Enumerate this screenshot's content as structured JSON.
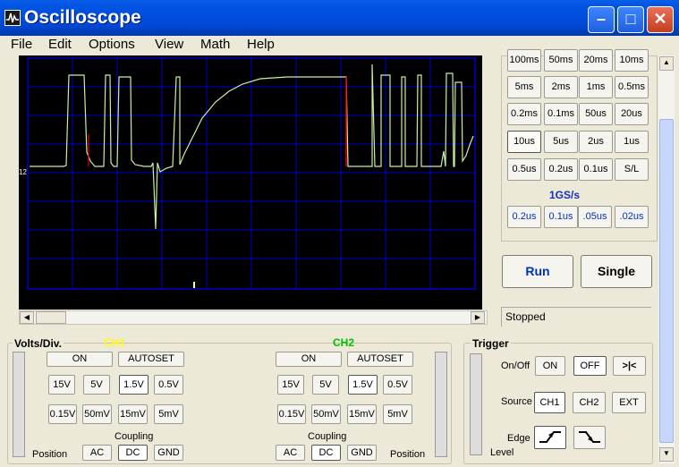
{
  "window": {
    "title": "Oscilloscope"
  },
  "menu": [
    "File",
    "Edit",
    "Options",
    "View",
    "Math",
    "Help"
  ],
  "timebase": {
    "rows": [
      [
        "100ms",
        "50ms",
        "20ms",
        "10ms"
      ],
      [
        "5ms",
        "2ms",
        "1ms",
        "0.5ms"
      ],
      [
        "0.2ms",
        "0.1ms",
        "50us",
        "20us"
      ],
      [
        "10us",
        "5us",
        "2us",
        "1us"
      ],
      [
        "0.5us",
        "0.2us",
        "0.1us",
        "S/L"
      ]
    ],
    "selected": "10us",
    "sample_rate": "1GS/s",
    "fast": [
      ".2us",
      ".1us",
      ".05us",
      ".02us"
    ]
  },
  "fast_display": [
    "0.2us",
    "0.1us",
    ".05us",
    ".02us"
  ],
  "controls": {
    "run": "Run",
    "single": "Single",
    "status": "Stopped"
  },
  "volts": {
    "title": "Volts/Div.",
    "ch1": "CH1",
    "ch2": "CH2",
    "on": "ON",
    "autoset": "AUTOSET",
    "row1": [
      "15V",
      "5V",
      "1.5V",
      "0.5V"
    ],
    "row2": [
      "0.15V",
      "50mV",
      "15mV",
      "5mV"
    ],
    "coupling": "Coupling",
    "position": "Position",
    "ac": "AC",
    "dc": "DC",
    "gnd": "GND",
    "ch1_color": "#ffff00",
    "ch2_color": "#00e000"
  },
  "trigger": {
    "title": "Trigger",
    "onoff": "On/Off",
    "on": "ON",
    "off": "OFF",
    "center": ">|<",
    "source": "Source",
    "ch1": "CH1",
    "ch2": "CH2",
    "ext": "EXT",
    "edge": "Edge",
    "level": "Level"
  },
  "scope": {
    "marker": "12",
    "trace_color": "#c8f0a0",
    "grid_color": "#0000c8"
  }
}
